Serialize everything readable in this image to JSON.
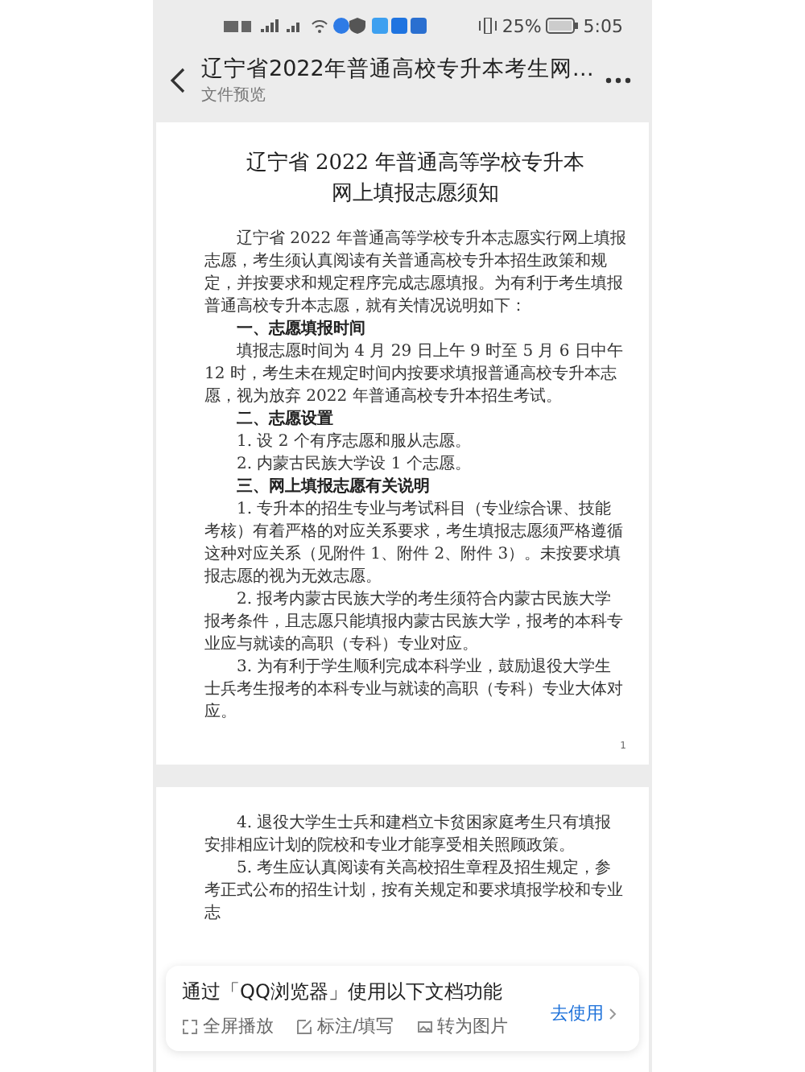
{
  "status_bar": {
    "battery_percent": "25%",
    "time": "5:05"
  },
  "header": {
    "title": "辽宁省2022年普通高校专升本考生网…",
    "subtitle": "文件预览"
  },
  "pages": [
    {
      "blocks": [
        {
          "kind": "title",
          "text": "辽宁省 2022 年普通高等学校专升本"
        },
        {
          "kind": "title",
          "text": "网上填报志愿须知"
        },
        {
          "kind": "para",
          "text": "辽宁省 2022 年普通高等学校专升本志愿实行网上填报志愿，考生须认真阅读有关普通高校专升本招生政策和规定，并按要求和规定程序完成志愿填报。为有利于考生填报普通高校专升本志愿，就有关情况说明如下："
        },
        {
          "kind": "heading",
          "text": "一、志愿填报时间"
        },
        {
          "kind": "para",
          "text": "填报志愿时间为 4 月 29 日上午 9 时至 5 月 6 日中午 12 时，考生未在规定时间内按要求填报普通高校专升本志愿，视为放弃 2022 年普通高校专升本招生考试。"
        },
        {
          "kind": "heading",
          "text": "二、志愿设置"
        },
        {
          "kind": "para",
          "text": "1. 设 2 个有序志愿和服从志愿。"
        },
        {
          "kind": "para",
          "text": "2. 内蒙古民族大学设 1 个志愿。"
        },
        {
          "kind": "heading",
          "text": "三、网上填报志愿有关说明"
        },
        {
          "kind": "para",
          "text": "1. 专升本的招生专业与考试科目（专业综合课、技能考核）有着严格的对应关系要求，考生填报志愿须严格遵循这种对应关系（见附件 1、附件 2、附件 3）。未按要求填报志愿的视为无效志愿。"
        },
        {
          "kind": "para",
          "text": "2. 报考内蒙古民族大学的考生须符合内蒙古民族大学报考条件，且志愿只能填报内蒙古民族大学，报考的本科专业应与就读的高职（专科）专业对应。"
        },
        {
          "kind": "para",
          "text": "3. 为有利于学生顺利完成本科学业，鼓励退役大学生士兵考生报考的本科专业与就读的高职（专科）专业大体对应。"
        },
        {
          "kind": "page_number",
          "text": "1"
        }
      ]
    },
    {
      "blocks": [
        {
          "kind": "para",
          "text": "4. 退役大学生士兵和建档立卡贫困家庭考生只有填报安排相应计划的院校和专业才能享受相关照顾政策。"
        },
        {
          "kind": "para",
          "text": "5. 考生应认真阅读有关高校招生章程及招生规定，参考正式公布的招生计划，按有关规定和要求填报学校和专业志"
        }
      ]
    }
  ],
  "popup": {
    "message": "通过「QQ浏览器」使用以下文档功能",
    "actions": [
      {
        "kind": "fullscreen",
        "label": "全屏播放"
      },
      {
        "kind": "annotate",
        "label": "标注/填写"
      },
      {
        "kind": "image",
        "label": "转为图片"
      }
    ],
    "link": "去使用"
  }
}
